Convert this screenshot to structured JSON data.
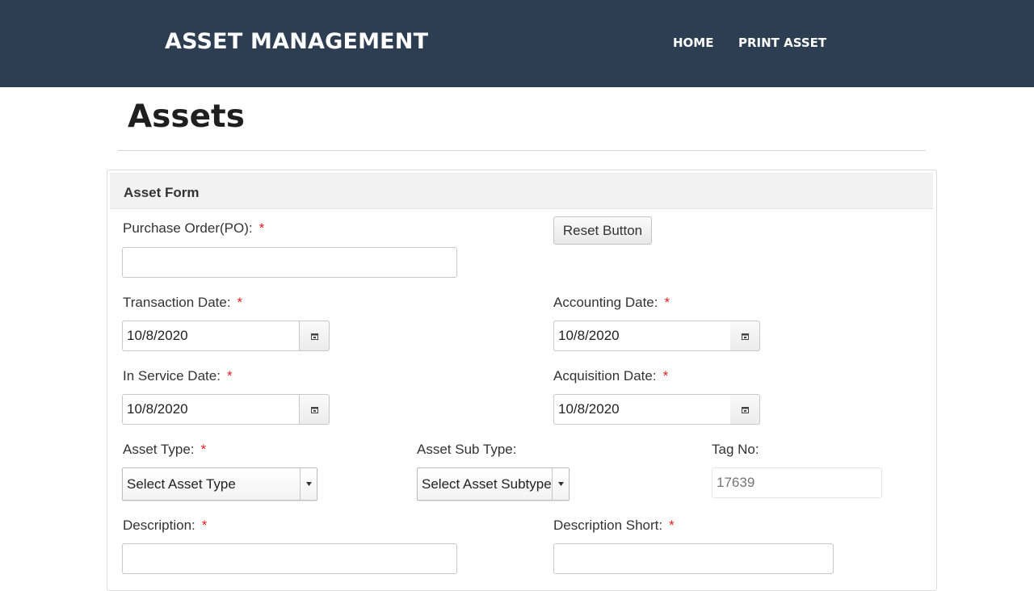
{
  "header": {
    "brand": "ASSET MANAGEMENT",
    "nav": {
      "home": "HOME",
      "print_asset": "PRINT ASSET"
    }
  },
  "page": {
    "title": "Assets"
  },
  "form": {
    "title": "Asset Form",
    "required_mark": "*",
    "reset_label": "Reset Button",
    "purchase_order": {
      "label": "Purchase Order(PO):",
      "value": ""
    },
    "transaction_date": {
      "label": "Transaction Date:",
      "value": "10/8/2020"
    },
    "accounting_date": {
      "label": "Accounting Date:",
      "value": "10/8/2020"
    },
    "in_service_date": {
      "label": "In Service Date:",
      "value": "10/8/2020"
    },
    "acquisition_date": {
      "label": "Acquisition Date:",
      "value": "10/8/2020"
    },
    "asset_type": {
      "label": "Asset Type:",
      "selected": "Select Asset Type"
    },
    "asset_sub_type": {
      "label": "Asset Sub Type:",
      "selected": "Select Asset Subtype"
    },
    "tag_no": {
      "label": "Tag No:",
      "placeholder": "17639"
    },
    "description": {
      "label": "Description:",
      "value": ""
    },
    "description_short": {
      "label": "Description Short:",
      "value": ""
    }
  },
  "icons": {
    "calendar": "calendar-icon",
    "dropdown": "chevron-down-icon"
  },
  "colors": {
    "header_bg": "#2e3e52",
    "required": "#e0211c",
    "panel_head_bg": "#f2f2f2"
  }
}
